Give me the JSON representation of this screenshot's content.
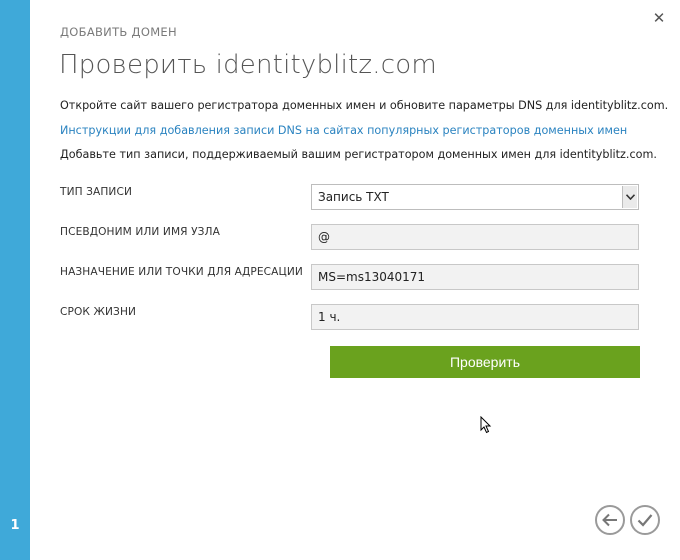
{
  "sidebar": {
    "step_number": "1"
  },
  "dialog": {
    "overline": "ДОБАВИТЬ ДОМЕН",
    "title": "Проверить identityblitz.com",
    "intro": "Откройте сайт вашего регистратора доменных имен и обновите параметры DNS для identityblitz.com.",
    "instructions_link": "Инструкции для добавления записи DNS на сайтах популярных регистраторов доменных имен",
    "add_record_text": "Добавьте тип записи, поддерживаемый вашим регистратором доменных имен для identityblitz.com.",
    "close_icon": "close-icon"
  },
  "form": {
    "record_type": {
      "label": "ТИП ЗАПИСИ",
      "value": "Запись TXT"
    },
    "alias": {
      "label": "ПСЕВДОНИМ ИЛИ ИМЯ УЗЛА",
      "value": "@"
    },
    "target": {
      "label": "НАЗНАЧЕНИЕ ИЛИ ТОЧКИ ДЛЯ АДРЕСАЦИИ",
      "value": "MS=ms13040171"
    },
    "ttl": {
      "label": "СРОК ЖИЗНИ",
      "value": "1 ч."
    },
    "verify_button": "Проверить"
  },
  "footer": {
    "back_icon": "arrow-left-icon",
    "done_icon": "checkmark-icon"
  },
  "colors": {
    "side_strip": "#3fa9d9",
    "verify_button": "#6aa21e",
    "link": "#2a83c0"
  }
}
